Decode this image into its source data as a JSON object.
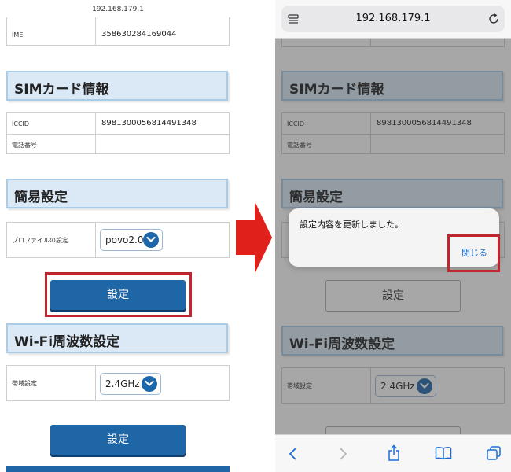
{
  "left": {
    "url": "192.168.179.1",
    "imei_label": "IMEI",
    "imei_value": "358630284169044",
    "sim_header": "SIMカード情報",
    "iccid_label": "ICCID",
    "iccid_value": "8981300056814491348",
    "phone_label": "電話番号",
    "phone_value": "",
    "easy_header": "簡易設定",
    "profile_label": "プロファイルの設定",
    "profile_value": "povo2.0",
    "set_button": "設定",
    "wifi_header": "Wi-Fi周波数設定",
    "band_label": "帯域設定",
    "band_value": "2.4GHz",
    "set_button2": "設定"
  },
  "right": {
    "url": "192.168.179.1",
    "sim_header": "SIMカード情報",
    "iccid_label": "ICCID",
    "iccid_value": "8981300056814491348",
    "phone_label": "電話番号",
    "easy_header": "簡易設定",
    "set_button": "設定",
    "wifi_header": "Wi-Fi周波数設定",
    "band_label": "帯域設定",
    "band_value": "2.4GHz",
    "dialog_message": "設定内容を更新しました。",
    "dialog_close": "閉じる"
  },
  "colors": {
    "accent": "#1f66a6",
    "highlight": "#c0272d",
    "arrow": "#e0201a",
    "header_bg": "#dbe9f7"
  },
  "icons": [
    "reader-icon",
    "reload-icon",
    "back-icon",
    "forward-icon",
    "share-icon",
    "bookmarks-icon",
    "tabs-icon",
    "arrow-right-icon",
    "chevron-down-icon"
  ]
}
